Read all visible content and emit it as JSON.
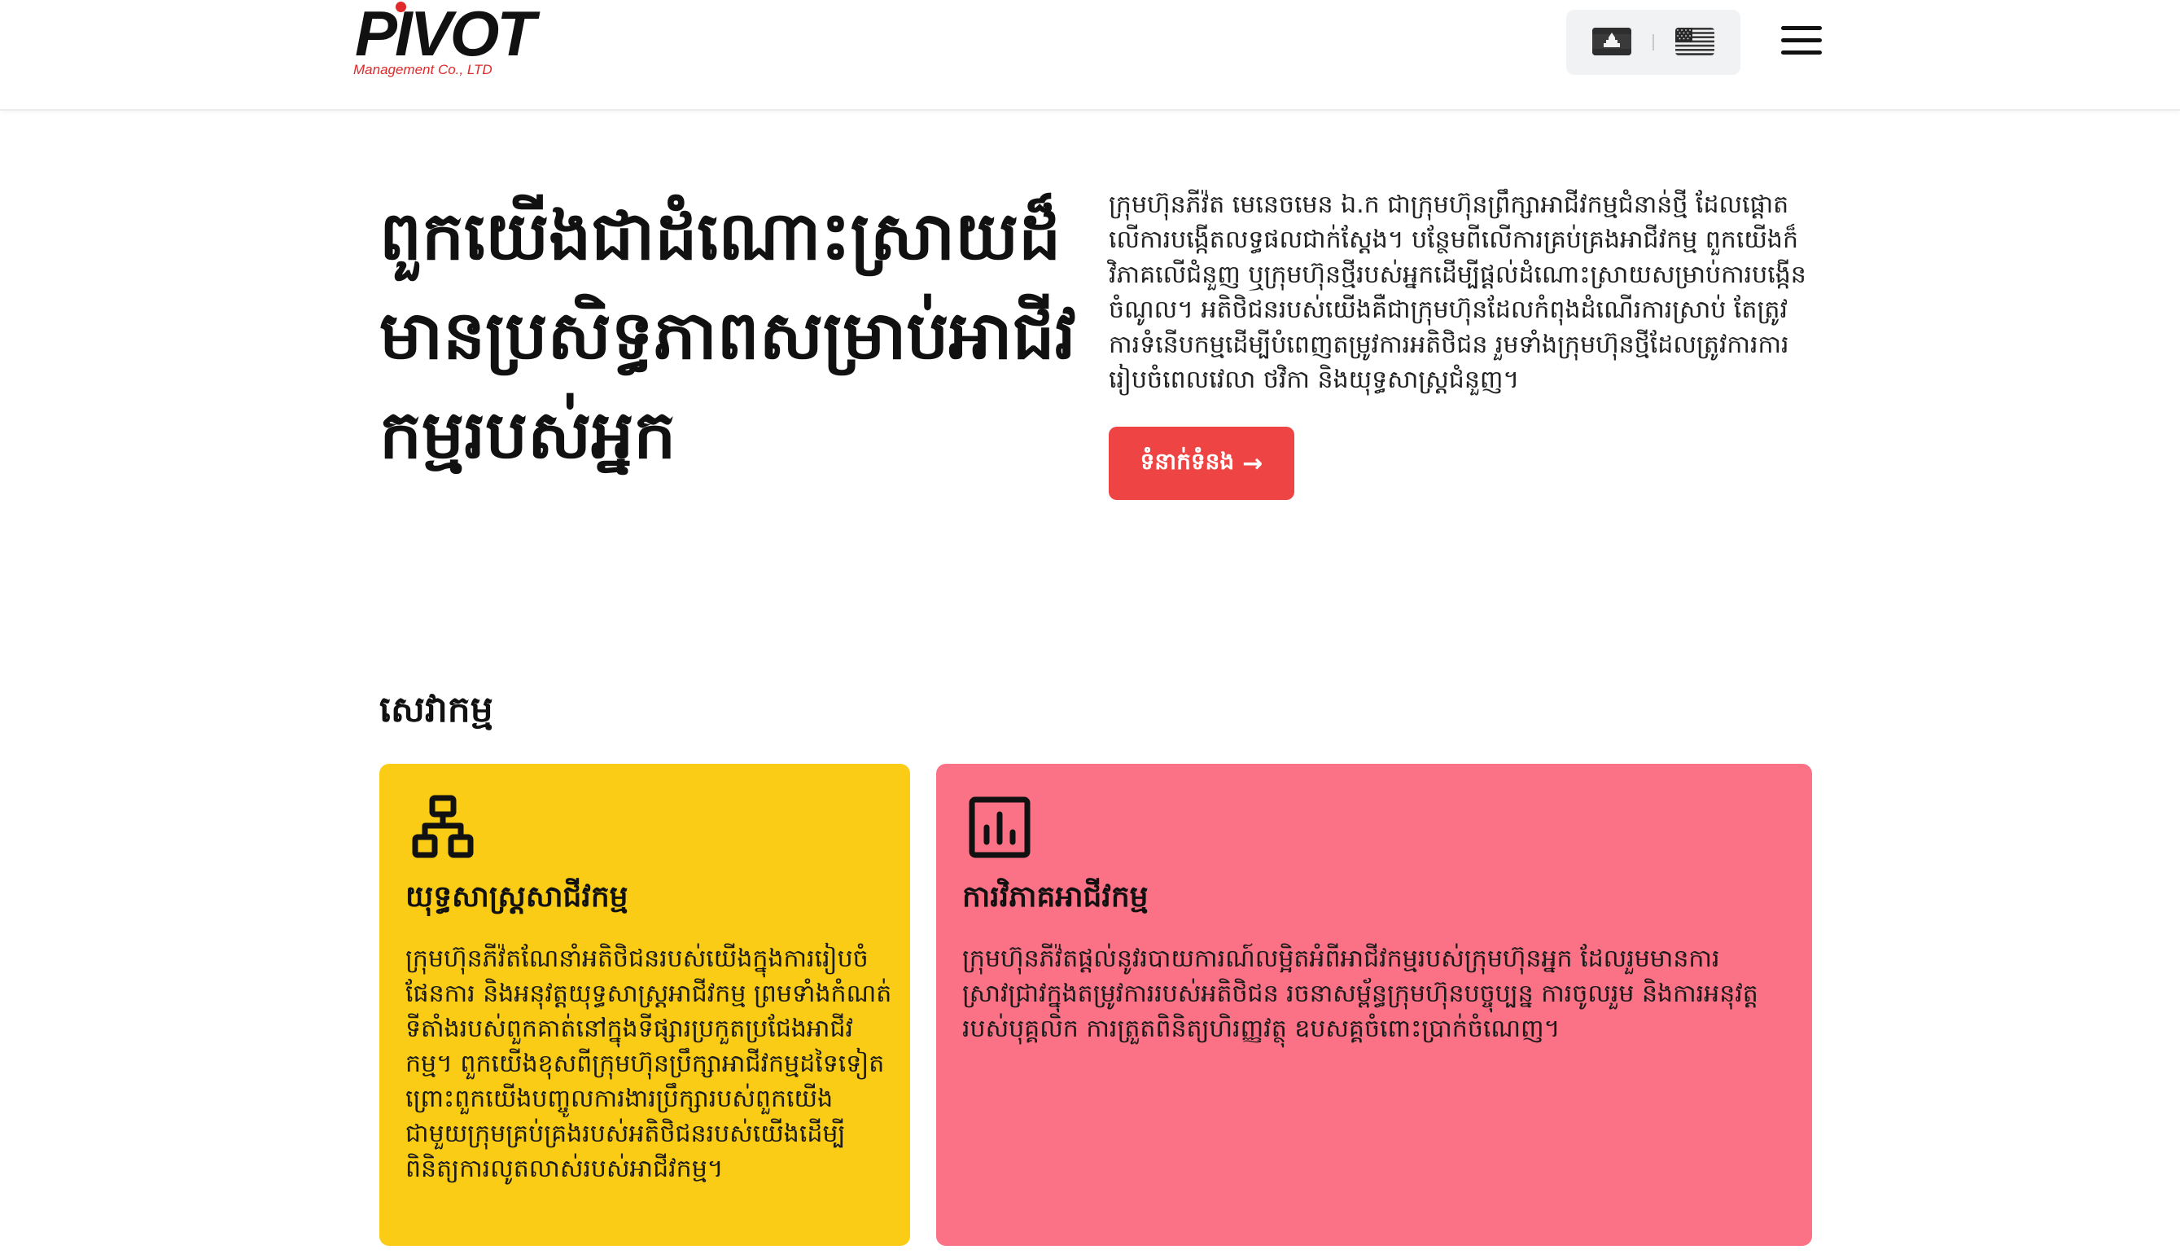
{
  "brand": {
    "name": "PIVOT",
    "subtitle": "Management Co., LTD",
    "accent_color": "#e02a2a"
  },
  "header": {
    "languages": [
      {
        "code": "km",
        "icon": "cambodia-flag-icon"
      },
      {
        "code": "en",
        "icon": "us-flag-icon"
      }
    ],
    "menu_icon": "hamburger-menu-icon"
  },
  "hero": {
    "title": "ពួកយើងជាដំណោះស្រាយដ៏មានប្រសិទ្ធភាពសម្រាប់អាជីវកម្មរបស់អ្នក",
    "description": "ក្រុមហ៊ុនភីវ៉ត មេនេចមេន ឯ.ក ជាក្រុមហ៊ុនព្រឹក្សាអាជីវកម្មជំនាន់ថ្មី ដែលផ្តោតលើការបង្កើតលទ្ធផលជាក់ស្តែង។ បន្ថែមពីលើការគ្រប់គ្រងអាជីវកម្ម ពួកយើងក៏វិភាគលើជំនួញ ឬក្រុមហ៊ុនថ្មីរបស់អ្នកដើម្បីផ្តល់ដំណោះស្រាយសម្រាប់ការបង្កើនចំណូល។ អតិថិជនរបស់យើងគឺជាក្រុមហ៊ុនដែលកំពុងដំណើរការស្រាប់ តែត្រូវការទំនើបកម្មដើម្បីបំពេញតម្រូវការអតិថិជន រួមទាំងក្រុមហ៊ុនថ្មីដែលត្រូវការការរៀបចំពេលវេលា ថវិកា និងយុទ្ធសាស្រ្តជំនួញ។",
    "cta_label": "ទំនាក់ទំនង",
    "cta_icon": "arrow-right-icon",
    "cta_color": "#ef4444"
  },
  "services": {
    "title": "សេវាកម្ម",
    "cards": [
      {
        "icon": "hierarchy-icon",
        "title": "យុទ្ធសាស្រ្តសាជីវកម្ម",
        "text": "ក្រុមហ៊ុនភីវ៉តណែនាំអតិថិជនរបស់យើងក្នុងការរៀបចំផែនការ និងអនុវត្តយុទ្ធសាស្រ្តអាជីវកម្ម ព្រមទាំងកំណត់ទីតាំងរបស់ពួកគាត់នៅក្នុងទីផ្សារប្រកួតប្រជែងអាជីវកម្ម។ ពួកយើងខុសពីក្រុមហ៊ុនប្រឹក្សាអាជីវកម្មដទៃទៀត ព្រោះពួកយើងបញ្ចូលការងារប្រឹក្សារបស់ពួកយើងជាមួយក្រុមគ្រប់គ្រងរបស់អតិថិជនរបស់យើងដើម្បីពិនិត្យការលូតលាស់របស់អាជីវកម្ម។",
        "color": "#facc15"
      },
      {
        "icon": "bar-chart-icon",
        "title": "ការវិភាគអាជីវកម្ម",
        "text": "ក្រុមហ៊ុនភីវ៉តផ្តល់នូវរបាយការណ៍លម្អិតអំពីអាជីវកម្មរបស់ក្រុមហ៊ុនអ្នក ដែលរួមមានការស្រាវជ្រាវក្នុងតម្រូវការរបស់អតិថិជន រចនាសម្ព័ន្ធក្រុមហ៊ុនបច្ចុប្បន្ន ការចូលរួម និងការអនុវត្តរបស់បុគ្គលិក ការត្រួតពិនិត្យហិរញ្ញវត្ថុ ឧបសគ្គចំពោះប្រាក់ចំណេញ។",
        "color": "#fb7185"
      }
    ]
  }
}
